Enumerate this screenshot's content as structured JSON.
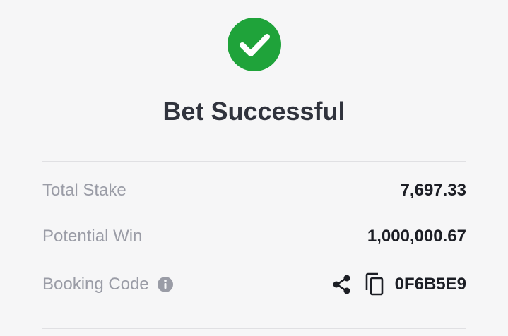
{
  "status": {
    "title": "Bet Successful",
    "icon": "check-circle-icon",
    "icon_color": "#1fa33a"
  },
  "summary": {
    "total_stake": {
      "label": "Total Stake",
      "value": "7,697.33"
    },
    "potential_win": {
      "label": "Potential Win",
      "value": "1,000,000.67"
    },
    "booking_code": {
      "label": "Booking Code",
      "value": "0F6B5E9",
      "info_icon": "info-icon",
      "share_icon": "share-icon",
      "copy_icon": "copy-icon"
    }
  },
  "colors": {
    "background": "#f6f6f7",
    "label": "#9a9ca6",
    "value": "#1c1e25",
    "title": "#30333d",
    "divider": "#e0e0e3"
  }
}
